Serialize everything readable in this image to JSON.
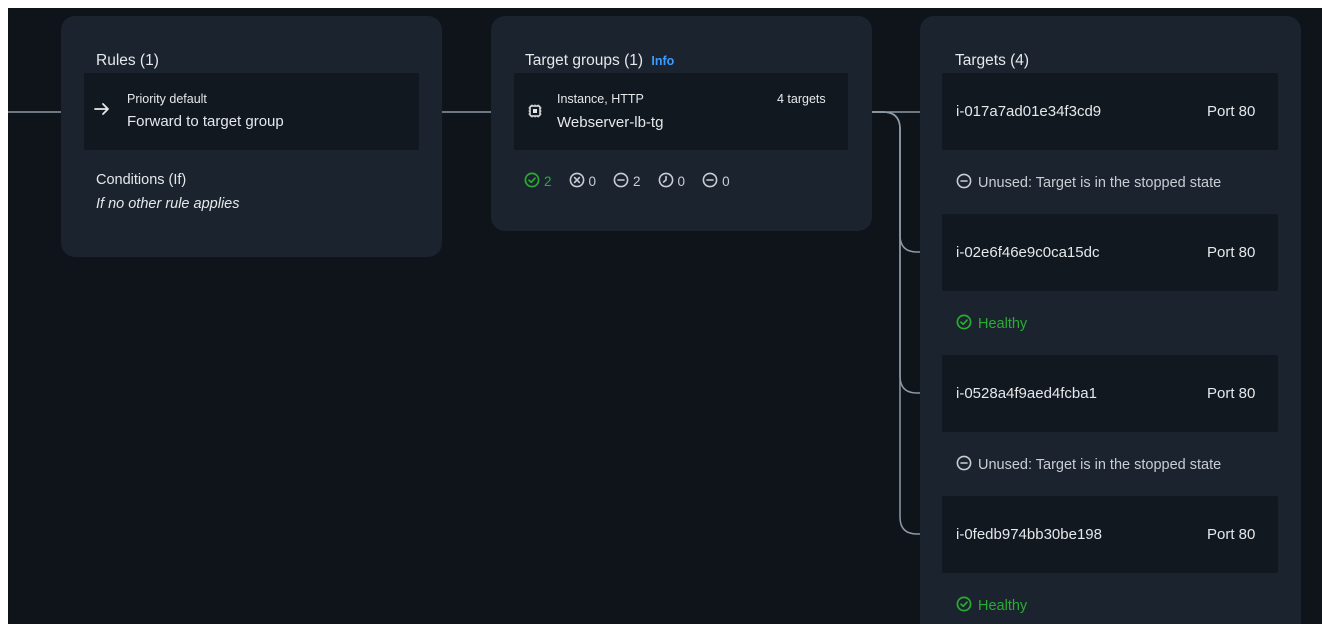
{
  "rules_panel": {
    "title": "Rules (1)",
    "rule": {
      "priority": "Priority default",
      "action": "Forward to target group"
    },
    "conditions_title": "Conditions (If)",
    "conditions_value": "If no other rule applies"
  },
  "target_groups_panel": {
    "title": "Target groups (1)",
    "info_label": "Info",
    "group": {
      "type": "Instance, HTTP",
      "name": "Webserver-lb-tg",
      "target_count": "4 targets"
    },
    "counts": [
      {
        "icon": "check-circle-icon",
        "value": "2",
        "color": "#29ad32"
      },
      {
        "icon": "x-circle-icon",
        "value": "0",
        "color": "#c9ced4"
      },
      {
        "icon": "minus-circle-icon",
        "value": "2",
        "color": "#c9ced4"
      },
      {
        "icon": "clock-icon",
        "value": "0",
        "color": "#c9ced4"
      },
      {
        "icon": "minus-circle-icon",
        "value": "0",
        "color": "#c9ced4"
      }
    ]
  },
  "targets_panel": {
    "title": "Targets (4)",
    "targets": [
      {
        "id": "i-017a7ad01e34f3cd9",
        "port": "Port 80",
        "status": "Unused: Target is in the stopped state",
        "status_type": "unused"
      },
      {
        "id": "i-02e6f46e9c0ca15dc",
        "port": "Port 80",
        "status": "Healthy",
        "status_type": "healthy"
      },
      {
        "id": "i-0528a4f9aed4fcba1",
        "port": "Port 80",
        "status": "Unused: Target is in the stopped state",
        "status_type": "unused"
      },
      {
        "id": "i-0fedb974bb30be198",
        "port": "Port 80",
        "status": "Healthy",
        "status_type": "healthy"
      }
    ]
  },
  "colors": {
    "healthy": "#29ad32",
    "unused": "#c9ced4",
    "link": "#3d9bff",
    "connector": "#8d99a6"
  }
}
